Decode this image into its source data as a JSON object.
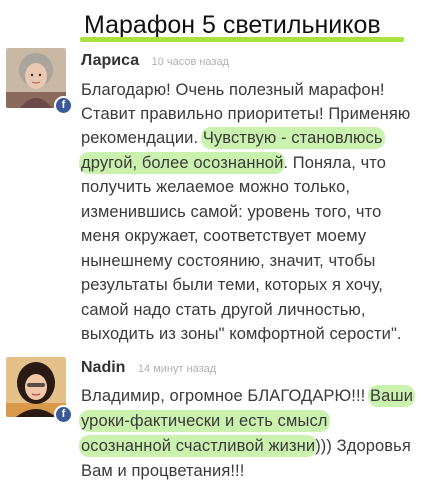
{
  "page": {
    "title": "Марафон 5 светильников"
  },
  "colors": {
    "highlight": "#a8e23a",
    "facebook": "#3b5998",
    "time_gray": "#b0b0b0"
  },
  "comments": [
    {
      "author": "Лариса",
      "time": "10 часов назад",
      "avatar_icon": "woman-portrait-gray-hair",
      "badge_icon": "facebook-icon",
      "badge_text": "f",
      "lines": [
        {
          "pre": "Благодарю! Очень полезный марафон!",
          "hl": "",
          "post": ""
        },
        {
          "pre": "Ставит правильно приоритеты! Применяю",
          "hl": "",
          "post": ""
        },
        {
          "pre": "рекомендации. ",
          "hl": "Чувствую - становлюсь",
          "post": ""
        },
        {
          "pre": "",
          "hl": "другой, более осознанной",
          "post": ". Поняла, что"
        },
        {
          "pre": "получить желаемое можно только,",
          "hl": "",
          "post": ""
        },
        {
          "pre": "изменившись самой: уровень того, что",
          "hl": "",
          "post": ""
        },
        {
          "pre": "меня окружает, соответствует моему",
          "hl": "",
          "post": ""
        },
        {
          "pre": "нынешнему состоянию, значит, чтобы",
          "hl": "",
          "post": ""
        },
        {
          "pre": "результаты были теми, которых я хочу,",
          "hl": "",
          "post": ""
        },
        {
          "pre": "самой надо стать другой личностью,",
          "hl": "",
          "post": ""
        },
        {
          "pre": "выходить из зоны\" комфортной серости\".",
          "hl": "",
          "post": ""
        }
      ]
    },
    {
      "author": "Nadin",
      "time": "14 минут назад",
      "avatar_icon": "woman-portrait-dark-hair",
      "badge_icon": "facebook-icon",
      "badge_text": "f",
      "lines": [
        {
          "pre": "Владимир, огромное БЛАГОДАРЮ!!! ",
          "hl": "Ваши",
          "post": ""
        },
        {
          "pre": "",
          "hl": "уроки-фактически и есть смысл",
          "post": ""
        },
        {
          "pre": "",
          "hl": "осознанной счастливой жизни",
          "post": "))) Здоровья"
        },
        {
          "pre": "Вам и процветания!!!",
          "hl": "",
          "post": ""
        }
      ]
    }
  ]
}
